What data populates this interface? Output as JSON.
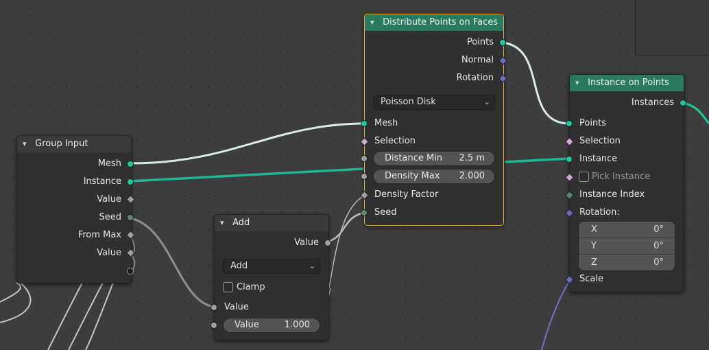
{
  "group_input": {
    "title": "Group Input",
    "outputs": [
      "Mesh",
      "Instance",
      "Value",
      "Seed",
      "From Max",
      "Value"
    ]
  },
  "add": {
    "title": "Add",
    "output": "Value",
    "operation": "Add",
    "clamp_label": "Clamp",
    "input_value_label": "Value",
    "value_field_label": "Value",
    "value_field_value": "1.000"
  },
  "distribute": {
    "title": "Distribute Points on Faces",
    "outputs": [
      "Points",
      "Normal",
      "Rotation"
    ],
    "mode": "Poisson Disk",
    "mesh_label": "Mesh",
    "selection_label": "Selection",
    "distance_min_label": "Distance Min",
    "distance_min_value": "2.5 m",
    "density_max_label": "Density Max",
    "density_max_value": "2.000",
    "density_factor_label": "Density Factor",
    "seed_label": "Seed"
  },
  "instance_on_points": {
    "title": "Instance on Points",
    "output": "Instances",
    "points_label": "Points",
    "selection_label": "Selection",
    "instance_label": "Instance",
    "pick_instance_label": "Pick Instance",
    "instance_index_label": "Instance Index",
    "rotation_label": "Rotation:",
    "rotation": [
      {
        "axis": "X",
        "value": "0°"
      },
      {
        "axis": "Y",
        "value": "0°"
      },
      {
        "axis": "Z",
        "value": "0°"
      }
    ],
    "scale_label": "Scale"
  },
  "colors": {
    "geometry_socket": "#1fc9a0",
    "vector_socket": "#6d6dc0",
    "float_socket": "#a1a1a1",
    "boolean_socket": "#cfa9d4",
    "int_socket": "#5b8c6a",
    "geometry_header": "#2a7a62",
    "active_outline": "#e8a82c"
  }
}
